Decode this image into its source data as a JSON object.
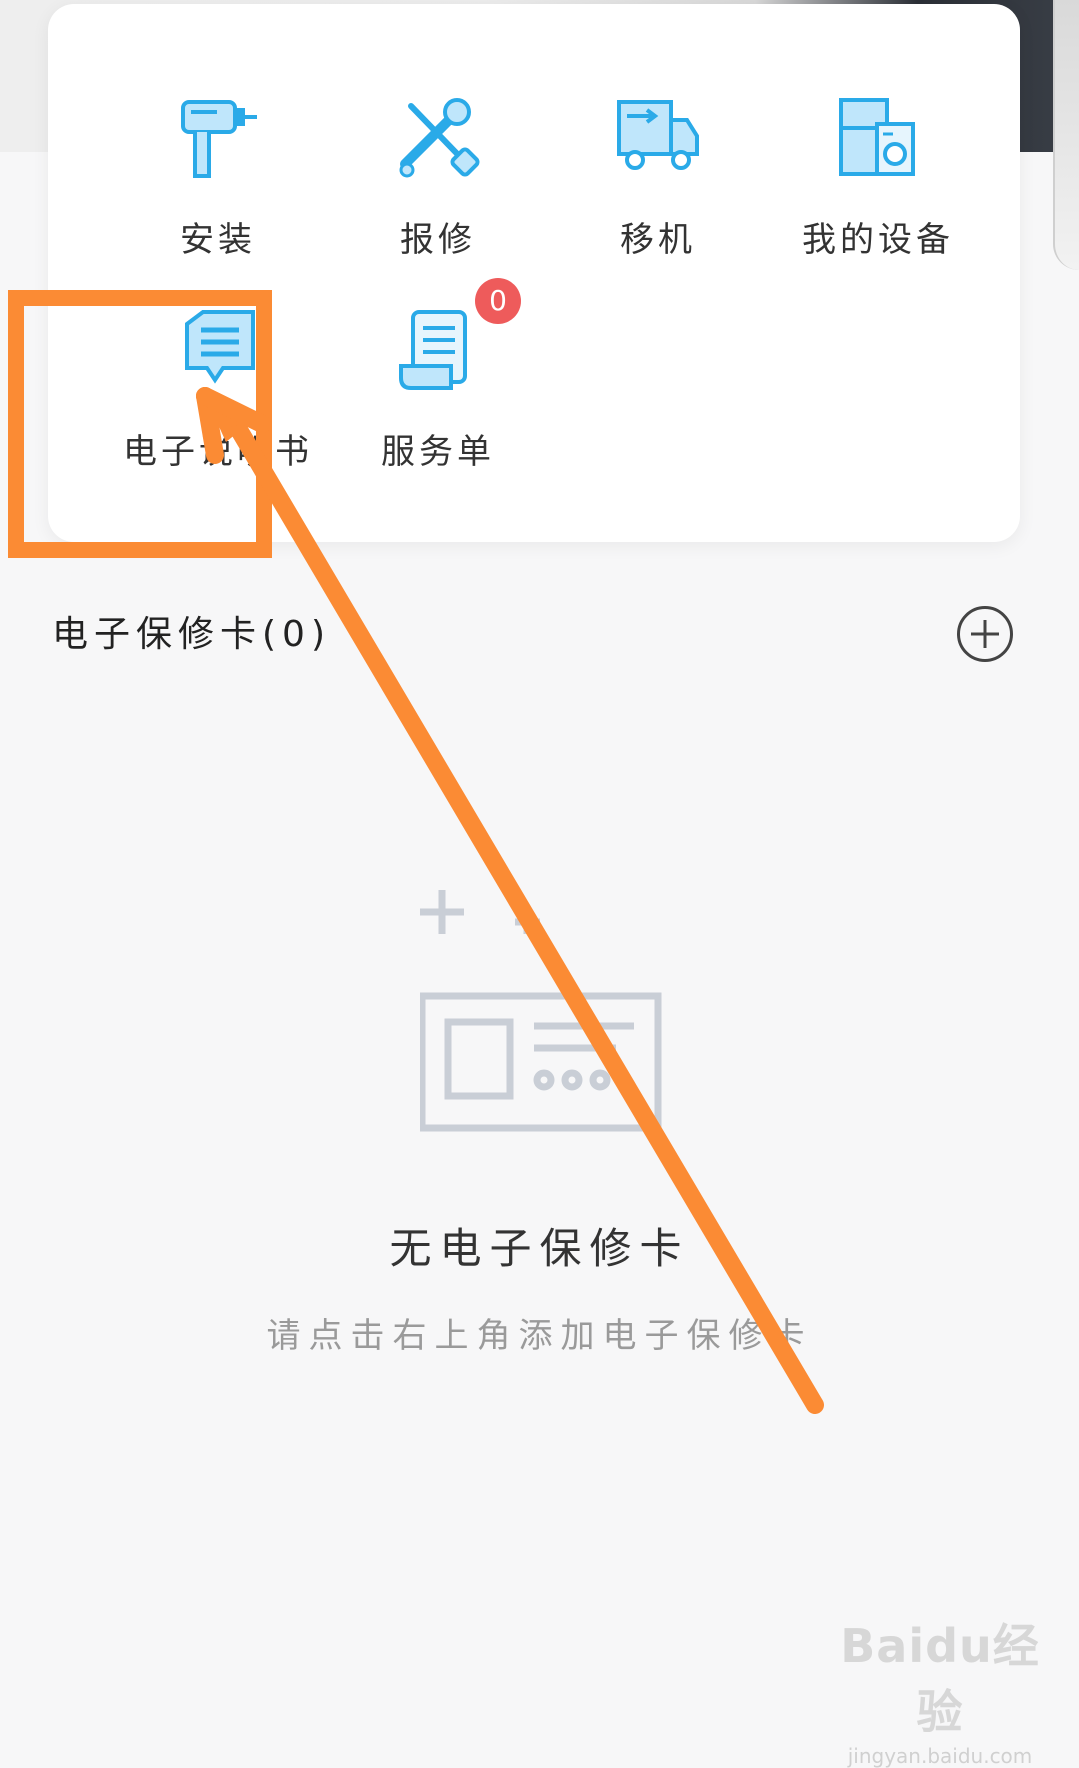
{
  "services": {
    "items": [
      {
        "label": "安装",
        "icon": "drill-icon"
      },
      {
        "label": "报修",
        "icon": "tools-icon"
      },
      {
        "label": "移机",
        "icon": "truck-icon"
      },
      {
        "label": "我的设备",
        "icon": "appliances-icon"
      },
      {
        "label": "电子说明书",
        "icon": "manual-icon"
      },
      {
        "label": "服务单",
        "icon": "service-order-icon",
        "badge": "0"
      }
    ]
  },
  "warranty": {
    "title": "电子保修卡(0)",
    "empty_title": "无电子保修卡",
    "empty_hint": "请点击右上角添加电子保修卡"
  },
  "watermark": {
    "logo": "Baidu经验",
    "url": "jingyan.baidu.com"
  },
  "colors": {
    "icon_blue": "#2aaae8",
    "icon_light": "#bfe6fb",
    "annotation_orange": "#fb8b34",
    "badge_red": "#ee5b5b"
  }
}
